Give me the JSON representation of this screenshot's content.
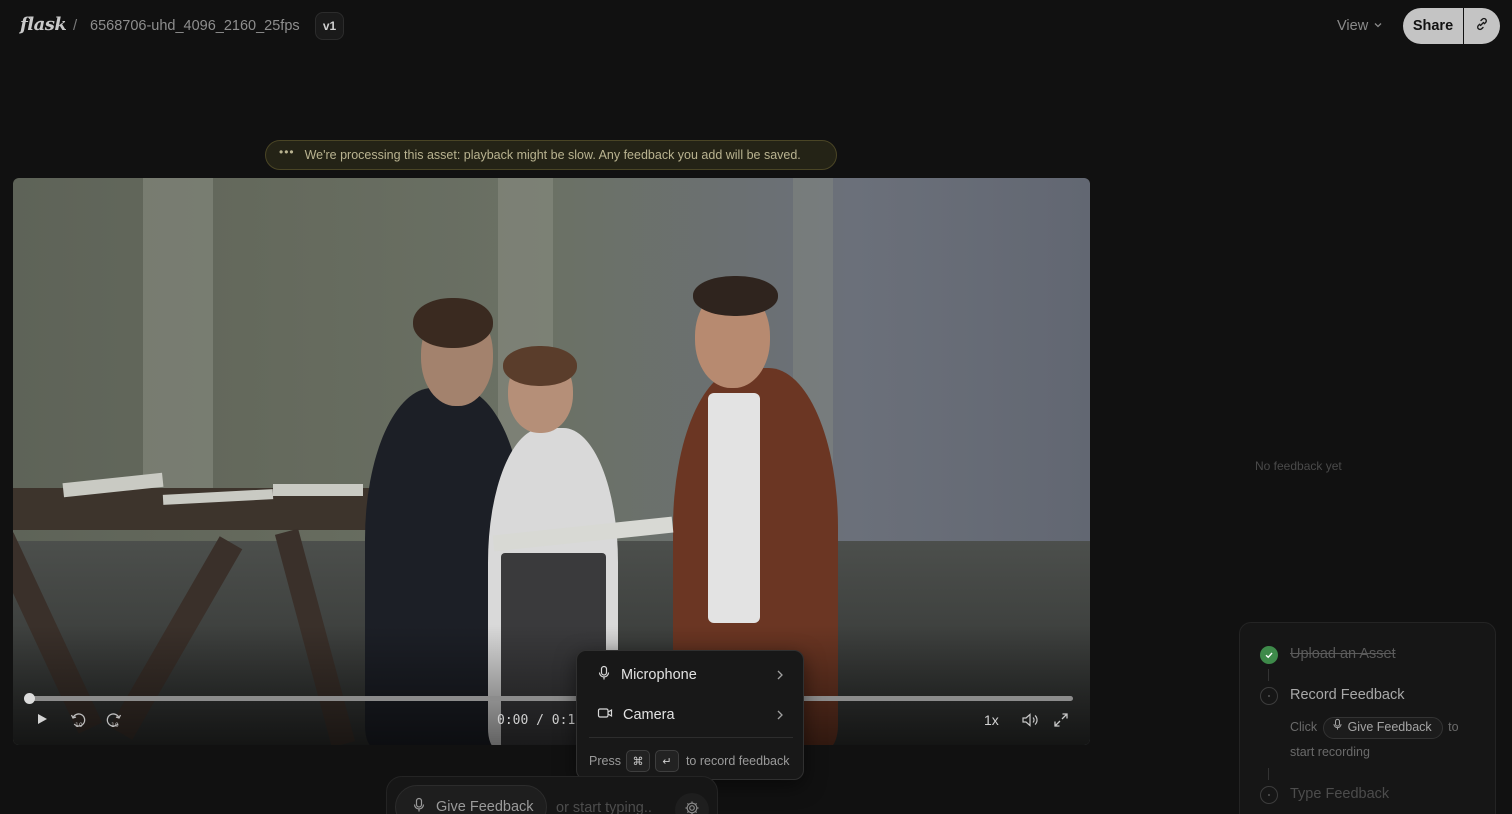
{
  "header": {
    "logo": "flask",
    "separator": "/",
    "asset_name": "6568706-uhd_4096_2160_25fps",
    "version": "v1",
    "view_label": "View",
    "share_label": "Share"
  },
  "banner": {
    "dots": "•••",
    "message": "We're processing this asset: playback might be slow. Any feedback you add will be saved."
  },
  "player": {
    "time": "0:00 / 0:1",
    "speed": "1x",
    "progress": 0
  },
  "device_menu": {
    "items": [
      {
        "label": "Microphone",
        "icon": "microphone-icon"
      },
      {
        "label": "Camera",
        "icon": "camera-icon"
      }
    ],
    "hint_prefix": "Press",
    "key_cmd": "⌘",
    "key_enter": "↵",
    "hint_suffix": "to record feedback"
  },
  "input_bar": {
    "give_feedback_label": "Give Feedback",
    "placeholder": "or start typing.."
  },
  "feedback_panel": {
    "empty_text": "No feedback yet"
  },
  "onboarding": {
    "steps": [
      {
        "title": "Upload an Asset",
        "status": "done"
      },
      {
        "title": "Record Feedback",
        "status": "active"
      },
      {
        "title": "Type Feedback",
        "status": "pending"
      }
    ],
    "desc_before": "Click",
    "chip_label": "Give Feedback",
    "desc_after": "to start recording"
  },
  "colors": {
    "background": "#111111",
    "share_button": "#c4c4c4",
    "done_green": "#3e8a4a",
    "banner_text": "#b9b390"
  }
}
